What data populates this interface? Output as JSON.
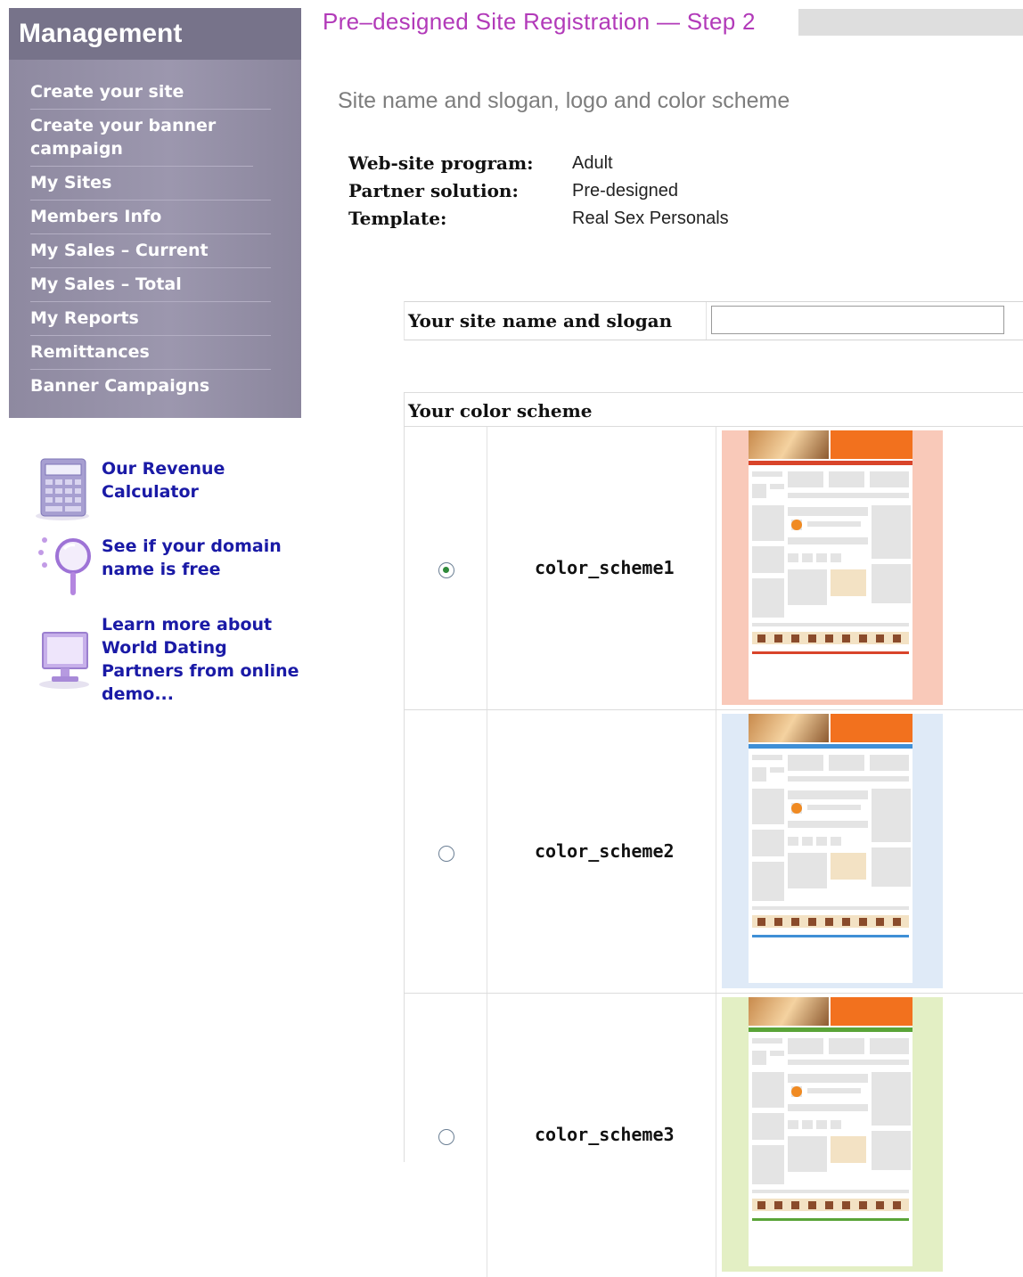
{
  "sidebar": {
    "title": "Management",
    "items": [
      {
        "label": "Create your site"
      },
      {
        "label": "Create your banner campaign"
      },
      {
        "label": "My Sites"
      },
      {
        "label": "Members Info"
      },
      {
        "label": "My Sales – Current"
      },
      {
        "label": "My Sales – Total"
      },
      {
        "label": "My Reports"
      },
      {
        "label": "Remittances"
      },
      {
        "label": "Banner Campaigns"
      }
    ]
  },
  "promos": [
    {
      "label": "Our Revenue Calculator",
      "icon": "calculator-icon"
    },
    {
      "label": "See if your domain name is free",
      "icon": "magnifier-icon"
    },
    {
      "label": "Learn more about World Dating Partners from online demo...",
      "icon": "monitor-icon"
    }
  ],
  "page": {
    "title": "Pre–designed Site Registration — Step 2",
    "section_title": "Site name and slogan, logo and color scheme"
  },
  "info": [
    {
      "label": "Web-site program:",
      "value": "Adult"
    },
    {
      "label": "Partner solution:",
      "value": "Pre-designed"
    },
    {
      "label": "Template:",
      "value": "Real Sex Personals"
    }
  ],
  "site_name": {
    "label": "Your site name and slogan",
    "value": ""
  },
  "color_scheme": {
    "header": "Your color scheme",
    "options": [
      {
        "name": "color_scheme1",
        "checked": true,
        "bg": "#f9c9b9",
        "accent": "#d9442a"
      },
      {
        "name": "color_scheme2",
        "checked": false,
        "bg": "#dfeaf7",
        "accent": "#3f8fd6"
      },
      {
        "name": "color_scheme3",
        "checked": false,
        "bg": "#e3efc4",
        "accent": "#5aa438"
      }
    ]
  },
  "colors": {
    "sidebar": "#9c97ae",
    "title": "#b23ab9",
    "link": "#1a1aa6"
  }
}
